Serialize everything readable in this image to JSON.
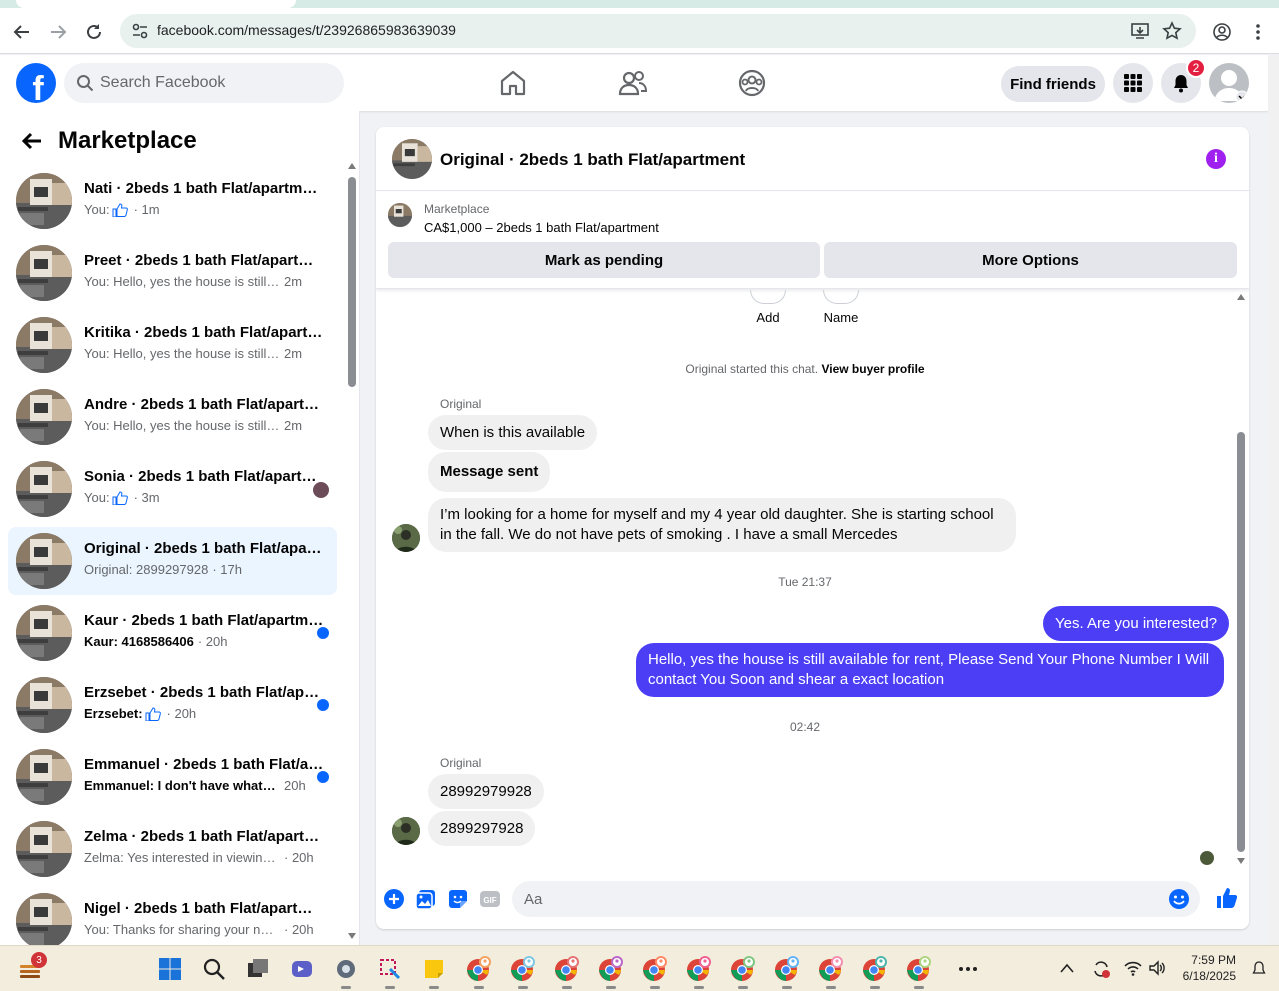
{
  "browser": {
    "url": "facebook.com/messages/t/23926865983639039"
  },
  "fb": {
    "logo_letter": "f",
    "search_placeholder": "Search Facebook",
    "find_friends": "Find friends",
    "notif_count": "2",
    "brand_color": "#0866ff"
  },
  "sidebar": {
    "title": "Marketplace",
    "conversations": [
      {
        "title": "Nati · 2beds 1 bath Flat/apartment",
        "preview": "You: ",
        "like": true,
        "time": "· 1m",
        "unread": false,
        "active": false
      },
      {
        "title": "Preet · 2beds 1 bath Flat/apartment",
        "preview": "You: Hello, yes the house is still av...",
        "like": false,
        "time": "2m",
        "unread": false,
        "active": false
      },
      {
        "title": "Kritika · 2beds 1 bath Flat/apartment",
        "preview": "You: Hello, yes the house is still av...",
        "like": false,
        "time": "2m",
        "unread": false,
        "active": false
      },
      {
        "title": "Andre · 2beds 1 bath Flat/apartment",
        "preview": "You: Hello, yes the house is still av...",
        "like": false,
        "time": "2m",
        "unread": false,
        "active": false
      },
      {
        "title": "Sonia · 2beds 1 bath Flat/apartment",
        "preview": "You: ",
        "like": true,
        "time": "· 3m",
        "unread": false,
        "active": false,
        "seen": true
      },
      {
        "title": "Original · 2beds 1 bath Flat/apartment",
        "preview": "Original: 2899297928",
        "like": false,
        "time": "· 17h",
        "unread": false,
        "active": true
      },
      {
        "title": "Kaur · 2beds 1 bath Flat/apartment",
        "preview": "Kaur: 4168586406",
        "like": false,
        "time": "· 20h",
        "unread": true,
        "active": false
      },
      {
        "title": "Erzsebet · 2beds 1 bath Flat/apartment",
        "preview": "Erzsebet: ",
        "like": true,
        "time": "· 20h",
        "unread": true,
        "active": false
      },
      {
        "title": "Emmanuel · 2beds 1 bath Flat/apartment",
        "preview": "Emmanuel: I don't have whata...",
        "like": false,
        "time": "20h",
        "unread": true,
        "active": false
      },
      {
        "title": "Zelma · 2beds 1 bath Flat/apartment",
        "preview": "Zelma: Yes interested in viewing p...",
        "like": false,
        "time": "· 20h",
        "unread": false,
        "active": false
      },
      {
        "title": "Nigel · 2beds 1 bath Flat/apartment",
        "preview": "You: Thanks for sharing your num...",
        "like": false,
        "time": "· 20h",
        "unread": false,
        "active": false
      }
    ]
  },
  "chat": {
    "title": "Original · 2beds 1 bath Flat/apartment",
    "listing": {
      "category": "Marketplace",
      "price_line": "CA$1,000 – 2beds 1 bath Flat/apartment",
      "mark_pending": "Mark as pending",
      "more_options": "More Options"
    },
    "quick_actions": [
      "Add",
      "Name"
    ],
    "started_text": "Original started this chat.",
    "view_profile": "View buyer profile",
    "sender_name": "Original",
    "messages_block1": [
      "When is this available",
      "Message sent",
      "I’m looking for a home for myself and my 4 year old daughter. She is starting school in the fall. We do not have pets of smoking . I have a small Mercedes"
    ],
    "ts1": "Tue 21:37",
    "outgoing": [
      "Yes. Are you interested?",
      "Hello, yes the house is still available for rent, Please Send Your Phone Number I Will contact You Soon and shear a exact location"
    ],
    "ts2": "02:42",
    "messages_block2": [
      "28992979928",
      "2899297928"
    ],
    "composer_placeholder": "Aa",
    "outgoing_color": "#4b3ef5",
    "accent_color": "#a020f0"
  },
  "taskbar": {
    "badge": "3",
    "time": "7:59 PM",
    "date": "6/18/2025"
  }
}
